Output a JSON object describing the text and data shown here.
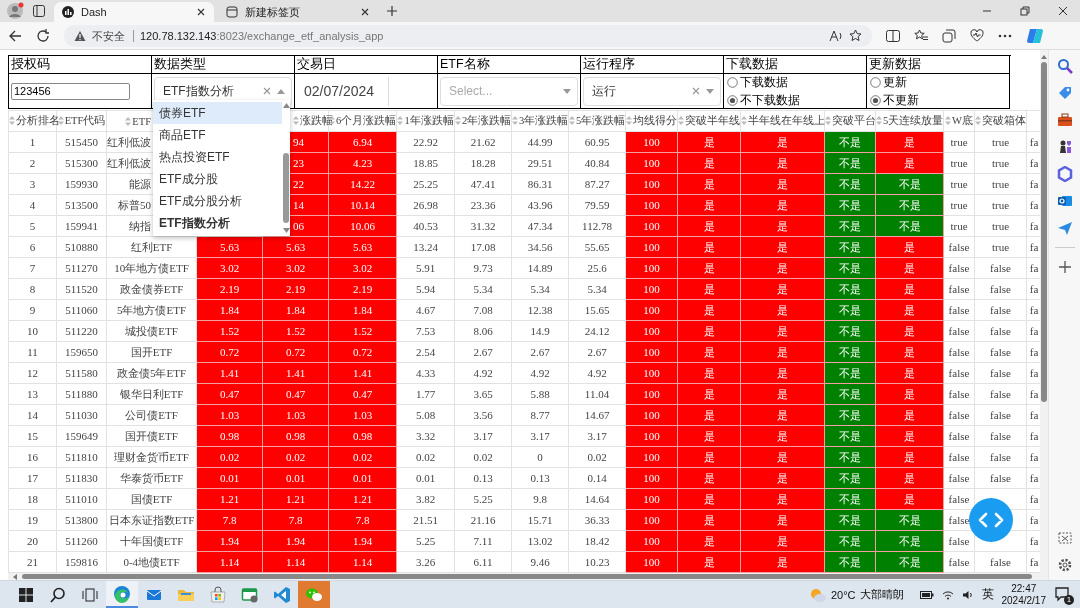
{
  "browser": {
    "tabs": [
      {
        "title": "Dash",
        "selected": true
      },
      {
        "title": "新建标签页",
        "selected": false
      }
    ],
    "security": "不安全",
    "url_host": "120.78.132.143",
    "url_path": ":8023/exchange_etf_analysis_app"
  },
  "form": {
    "fields": [
      {
        "kind": "text",
        "label": "授权码",
        "value": "123456"
      },
      {
        "kind": "dropdown",
        "label": "数据类型",
        "value": "ETF指数分析",
        "clearable": true,
        "expanded": true
      },
      {
        "kind": "date",
        "label": "交易日",
        "value": "02/07/2024"
      },
      {
        "kind": "select",
        "label": "ETF名称",
        "placeholder": "Select...",
        "clearable": false
      },
      {
        "kind": "select",
        "label": "运行程序",
        "value": "运行",
        "clearable": true
      },
      {
        "kind": "radio",
        "label": "下载数据",
        "options": [
          {
            "label": "下载数据",
            "selected": false
          },
          {
            "label": "不下载数据",
            "selected": true
          }
        ]
      },
      {
        "kind": "radio",
        "label": "更新数据",
        "options": [
          {
            "label": "更新",
            "selected": false
          },
          {
            "label": "不更新",
            "selected": true
          }
        ]
      }
    ]
  },
  "dropdown_menu": {
    "options": [
      {
        "label": "债券ETF",
        "highlighted": true,
        "selected": false
      },
      {
        "label": "商品ETF",
        "highlighted": false,
        "selected": false
      },
      {
        "label": "热点投资ETF",
        "highlighted": false,
        "selected": false
      },
      {
        "label": "ETF成分股",
        "highlighted": false,
        "selected": false
      },
      {
        "label": "ETF成分股分析",
        "highlighted": false,
        "selected": false
      },
      {
        "label": "ETF指数分析",
        "highlighted": false,
        "selected": true
      }
    ]
  },
  "table": {
    "columns": [
      "分析排名",
      "ETF代码",
      {
        "label": "ETF",
        "partial": true
      },
      null,
      {
        "label": "涨跌幅",
        "partial": true
      },
      "6个月涨跌幅",
      "1年涨跌幅",
      "2年涨跌幅",
      "3年涨跌幅",
      "5年涨跌幅",
      "均线得分",
      "突破半年线",
      "半年线在年线上",
      "突破平台",
      "5天连续放量",
      "W底",
      "突破箱体",
      null
    ],
    "rows": [
      {
        "cells": [
          "1",
          "515450",
          {
            "text": "红利低波",
            "partial": true
          },
          null,
          {
            "text": "94",
            "color": "#ff0000",
            "partial": true
          },
          {
            "text": "6.94",
            "color": "#ff0000"
          },
          "22.92",
          "21.62",
          "44.99",
          "60.95",
          {
            "text": "100",
            "color": "#ff0000"
          },
          {
            "text": "是",
            "color": "#ff0000"
          },
          {
            "text": "是",
            "color": "#ff0000"
          },
          {
            "text": "不是",
            "color": "#008000"
          },
          {
            "text": "是",
            "color": "#ff0000"
          },
          "true",
          "true",
          "fa"
        ]
      },
      {
        "cells": [
          "2",
          "515300",
          {
            "text": "红利低波",
            "partial": true
          },
          null,
          {
            "text": "23",
            "color": "#ff0000",
            "partial": true
          },
          {
            "text": "4.23",
            "color": "#ff0000"
          },
          "18.85",
          "18.28",
          "29.51",
          "40.84",
          {
            "text": "100",
            "color": "#ff0000"
          },
          {
            "text": "是",
            "color": "#ff0000"
          },
          {
            "text": "是",
            "color": "#ff0000"
          },
          {
            "text": "不是",
            "color": "#008000"
          },
          {
            "text": "是",
            "color": "#ff0000"
          },
          "true",
          "true",
          "fa"
        ]
      },
      {
        "cells": [
          "3",
          "159930",
          {
            "text": "能源",
            "partial": true
          },
          null,
          {
            "text": "22",
            "color": "#ff0000",
            "partial": true
          },
          {
            "text": "14.22",
            "color": "#ff0000"
          },
          "25.25",
          "47.41",
          "86.31",
          "87.27",
          {
            "text": "100",
            "color": "#ff0000"
          },
          {
            "text": "是",
            "color": "#ff0000"
          },
          {
            "text": "是",
            "color": "#ff0000"
          },
          {
            "text": "不是",
            "color": "#008000"
          },
          {
            "text": "不是",
            "color": "#008000"
          },
          "true",
          "true",
          "fa"
        ]
      },
      {
        "cells": [
          "4",
          "513500",
          {
            "text": "标普50",
            "partial": true
          },
          null,
          {
            "text": "14",
            "color": "#ff0000",
            "partial": true
          },
          {
            "text": "10.14",
            "color": "#ff0000"
          },
          "26.98",
          "23.36",
          "43.96",
          "79.59",
          {
            "text": "100",
            "color": "#ff0000"
          },
          {
            "text": "是",
            "color": "#ff0000"
          },
          {
            "text": "是",
            "color": "#ff0000"
          },
          {
            "text": "不是",
            "color": "#008000"
          },
          {
            "text": "不是",
            "color": "#008000"
          },
          "true",
          "true",
          "fa"
        ]
      },
      {
        "cells": [
          "5",
          "159941",
          {
            "text": "纳指",
            "partial": true
          },
          null,
          {
            "text": "06",
            "color": "#ff0000",
            "partial": true
          },
          {
            "text": "10.06",
            "color": "#ff0000"
          },
          "40.53",
          "31.32",
          "47.34",
          "112.78",
          {
            "text": "100",
            "color": "#ff0000"
          },
          {
            "text": "是",
            "color": "#ff0000"
          },
          {
            "text": "是",
            "color": "#ff0000"
          },
          {
            "text": "不是",
            "color": "#008000"
          },
          {
            "text": "不是",
            "color": "#008000"
          },
          "true",
          "true",
          "fa"
        ]
      },
      {
        "cells": [
          "6",
          "510880",
          "红利ETF",
          {
            "text": "5.63",
            "color": "#ff0000"
          },
          {
            "text": "5.63",
            "color": "#ff0000"
          },
          {
            "text": "5.63",
            "color": "#ff0000"
          },
          "13.24",
          "17.08",
          "34.56",
          "55.65",
          {
            "text": "100",
            "color": "#ff0000"
          },
          {
            "text": "是",
            "color": "#ff0000"
          },
          {
            "text": "是",
            "color": "#ff0000"
          },
          {
            "text": "不是",
            "color": "#008000"
          },
          {
            "text": "是",
            "color": "#ff0000"
          },
          "false",
          "true",
          "fa"
        ]
      },
      {
        "cells": [
          "7",
          "511270",
          "10年地方债ETF",
          {
            "text": "3.02",
            "color": "#ff0000"
          },
          {
            "text": "3.02",
            "color": "#ff0000"
          },
          {
            "text": "3.02",
            "color": "#ff0000"
          },
          "5.91",
          "9.73",
          "14.89",
          "25.6",
          {
            "text": "100",
            "color": "#ff0000"
          },
          {
            "text": "是",
            "color": "#ff0000"
          },
          {
            "text": "是",
            "color": "#ff0000"
          },
          {
            "text": "不是",
            "color": "#008000"
          },
          {
            "text": "是",
            "color": "#ff0000"
          },
          "false",
          "false",
          "fa"
        ]
      },
      {
        "cells": [
          "8",
          "511520",
          "政金债券ETF",
          {
            "text": "2.19",
            "color": "#ff0000"
          },
          {
            "text": "2.19",
            "color": "#ff0000"
          },
          {
            "text": "2.19",
            "color": "#ff0000"
          },
          "5.94",
          "5.34",
          "5.34",
          "5.34",
          {
            "text": "100",
            "color": "#ff0000"
          },
          {
            "text": "是",
            "color": "#ff0000"
          },
          {
            "text": "是",
            "color": "#ff0000"
          },
          {
            "text": "不是",
            "color": "#008000"
          },
          {
            "text": "是",
            "color": "#ff0000"
          },
          "false",
          "false",
          "fa"
        ]
      },
      {
        "cells": [
          "9",
          "511060",
          "5年地方债ETF",
          {
            "text": "1.84",
            "color": "#ff0000"
          },
          {
            "text": "1.84",
            "color": "#ff0000"
          },
          {
            "text": "1.84",
            "color": "#ff0000"
          },
          "4.67",
          "7.08",
          "12.38",
          "15.65",
          {
            "text": "100",
            "color": "#ff0000"
          },
          {
            "text": "是",
            "color": "#ff0000"
          },
          {
            "text": "是",
            "color": "#ff0000"
          },
          {
            "text": "不是",
            "color": "#008000"
          },
          {
            "text": "是",
            "color": "#ff0000"
          },
          "false",
          "false",
          "fa"
        ]
      },
      {
        "cells": [
          "10",
          "511220",
          "城投债ETF",
          {
            "text": "1.52",
            "color": "#ff0000"
          },
          {
            "text": "1.52",
            "color": "#ff0000"
          },
          {
            "text": "1.52",
            "color": "#ff0000"
          },
          "7.53",
          "8.06",
          "14.9",
          "24.12",
          {
            "text": "100",
            "color": "#ff0000"
          },
          {
            "text": "是",
            "color": "#ff0000"
          },
          {
            "text": "是",
            "color": "#ff0000"
          },
          {
            "text": "不是",
            "color": "#008000"
          },
          {
            "text": "是",
            "color": "#ff0000"
          },
          "false",
          "false",
          "fa"
        ]
      },
      {
        "cells": [
          "11",
          "159650",
          "国开ETF",
          {
            "text": "0.72",
            "color": "#ff0000"
          },
          {
            "text": "0.72",
            "color": "#ff0000"
          },
          {
            "text": "0.72",
            "color": "#ff0000"
          },
          "2.54",
          "2.67",
          "2.67",
          "2.67",
          {
            "text": "100",
            "color": "#ff0000"
          },
          {
            "text": "是",
            "color": "#ff0000"
          },
          {
            "text": "是",
            "color": "#ff0000"
          },
          {
            "text": "不是",
            "color": "#008000"
          },
          {
            "text": "是",
            "color": "#ff0000"
          },
          "false",
          "false",
          "fa"
        ]
      },
      {
        "cells": [
          "12",
          "511580",
          "政金债5年ETF",
          {
            "text": "1.41",
            "color": "#ff0000"
          },
          {
            "text": "1.41",
            "color": "#ff0000"
          },
          {
            "text": "1.41",
            "color": "#ff0000"
          },
          "4.33",
          "4.92",
          "4.92",
          "4.92",
          {
            "text": "100",
            "color": "#ff0000"
          },
          {
            "text": "是",
            "color": "#ff0000"
          },
          {
            "text": "是",
            "color": "#ff0000"
          },
          {
            "text": "不是",
            "color": "#008000"
          },
          {
            "text": "是",
            "color": "#ff0000"
          },
          "false",
          "false",
          "fa"
        ]
      },
      {
        "cells": [
          "13",
          "511880",
          "银华日利ETF",
          {
            "text": "0.47",
            "color": "#ff0000"
          },
          {
            "text": "0.47",
            "color": "#ff0000"
          },
          {
            "text": "0.47",
            "color": "#ff0000"
          },
          "1.77",
          "3.65",
          "5.88",
          "11.04",
          {
            "text": "100",
            "color": "#ff0000"
          },
          {
            "text": "是",
            "color": "#ff0000"
          },
          {
            "text": "是",
            "color": "#ff0000"
          },
          {
            "text": "不是",
            "color": "#008000"
          },
          {
            "text": "是",
            "color": "#ff0000"
          },
          "false",
          "false",
          "fa"
        ]
      },
      {
        "cells": [
          "14",
          "511030",
          "公司债ETF",
          {
            "text": "1.03",
            "color": "#ff0000"
          },
          {
            "text": "1.03",
            "color": "#ff0000"
          },
          {
            "text": "1.03",
            "color": "#ff0000"
          },
          "5.08",
          "3.56",
          "8.77",
          "14.67",
          {
            "text": "100",
            "color": "#ff0000"
          },
          {
            "text": "是",
            "color": "#ff0000"
          },
          {
            "text": "是",
            "color": "#ff0000"
          },
          {
            "text": "不是",
            "color": "#008000"
          },
          {
            "text": "是",
            "color": "#ff0000"
          },
          "false",
          "false",
          "fa"
        ]
      },
      {
        "cells": [
          "15",
          "159649",
          "国开债ETF",
          {
            "text": "0.98",
            "color": "#ff0000"
          },
          {
            "text": "0.98",
            "color": "#ff0000"
          },
          {
            "text": "0.98",
            "color": "#ff0000"
          },
          "3.32",
          "3.17",
          "3.17",
          "3.17",
          {
            "text": "100",
            "color": "#ff0000"
          },
          {
            "text": "是",
            "color": "#ff0000"
          },
          {
            "text": "是",
            "color": "#ff0000"
          },
          {
            "text": "不是",
            "color": "#008000"
          },
          {
            "text": "是",
            "color": "#ff0000"
          },
          "false",
          "false",
          "fa"
        ]
      },
      {
        "cells": [
          "16",
          "511810",
          "理财金货币ETF",
          {
            "text": "0.02",
            "color": "#ff0000"
          },
          {
            "text": "0.02",
            "color": "#ff0000"
          },
          {
            "text": "0.02",
            "color": "#ff0000"
          },
          "0.02",
          "0.02",
          "0",
          "0.02",
          {
            "text": "100",
            "color": "#ff0000"
          },
          {
            "text": "是",
            "color": "#ff0000"
          },
          {
            "text": "是",
            "color": "#ff0000"
          },
          {
            "text": "不是",
            "color": "#008000"
          },
          {
            "text": "是",
            "color": "#ff0000"
          },
          "false",
          "false",
          "fa"
        ]
      },
      {
        "cells": [
          "17",
          "511830",
          "华泰货币ETF",
          {
            "text": "0.01",
            "color": "#ff0000"
          },
          {
            "text": "0.01",
            "color": "#ff0000"
          },
          {
            "text": "0.01",
            "color": "#ff0000"
          },
          "0.01",
          "0.13",
          "0.13",
          "0.14",
          {
            "text": "100",
            "color": "#ff0000"
          },
          {
            "text": "是",
            "color": "#ff0000"
          },
          {
            "text": "是",
            "color": "#ff0000"
          },
          {
            "text": "不是",
            "color": "#008000"
          },
          {
            "text": "是",
            "color": "#ff0000"
          },
          "false",
          "false",
          "fa"
        ]
      },
      {
        "cells": [
          "18",
          "511010",
          "国债ETF",
          {
            "text": "1.21",
            "color": "#ff0000"
          },
          {
            "text": "1.21",
            "color": "#ff0000"
          },
          {
            "text": "1.21",
            "color": "#ff0000"
          },
          "3.82",
          "5.25",
          "9.8",
          "14.64",
          {
            "text": "100",
            "color": "#ff0000"
          },
          {
            "text": "是",
            "color": "#ff0000"
          },
          {
            "text": "是",
            "color": "#ff0000"
          },
          {
            "text": "不是",
            "color": "#008000"
          },
          {
            "text": "是",
            "color": "#ff0000"
          },
          "false",
          null,
          "fa"
        ]
      },
      {
        "cells": [
          "19",
          "513800",
          "日本东证指数ETF",
          {
            "text": "7.8",
            "color": "#ff0000"
          },
          {
            "text": "7.8",
            "color": "#ff0000"
          },
          {
            "text": "7.8",
            "color": "#ff0000"
          },
          "21.51",
          "21.16",
          "15.71",
          "36.33",
          {
            "text": "100",
            "color": "#ff0000"
          },
          {
            "text": "是",
            "color": "#ff0000"
          },
          {
            "text": "是",
            "color": "#ff0000"
          },
          {
            "text": "不是",
            "color": "#008000"
          },
          {
            "text": "不是",
            "color": "#008000"
          },
          "false",
          null,
          "fa"
        ]
      },
      {
        "cells": [
          "20",
          "511260",
          "十年国债ETF",
          {
            "text": "1.94",
            "color": "#ff0000"
          },
          {
            "text": "1.94",
            "color": "#ff0000"
          },
          {
            "text": "1.94",
            "color": "#ff0000"
          },
          "5.25",
          "7.11",
          "13.02",
          "18.42",
          {
            "text": "100",
            "color": "#ff0000"
          },
          {
            "text": "是",
            "color": "#ff0000"
          },
          {
            "text": "是",
            "color": "#ff0000"
          },
          {
            "text": "不是",
            "color": "#008000"
          },
          {
            "text": "不是",
            "color": "#008000"
          },
          "false",
          null,
          "fa"
        ]
      },
      {
        "cells": [
          "21",
          "159816",
          "0-4地债ETF",
          {
            "text": "1.14",
            "color": "#ff0000"
          },
          {
            "text": "1.14",
            "color": "#ff0000"
          },
          {
            "text": "1.14",
            "color": "#ff0000"
          },
          "3.26",
          "6.11",
          "9.46",
          "10.23",
          {
            "text": "100",
            "color": "#ff0000"
          },
          {
            "text": "是",
            "color": "#ff0000"
          },
          {
            "text": "是",
            "color": "#ff0000"
          },
          {
            "text": "不是",
            "color": "#008000"
          },
          {
            "text": "不是",
            "color": "#008000"
          },
          "false",
          "false",
          "fa"
        ]
      }
    ]
  },
  "taskbar": {
    "apps": [
      {
        "kind": "edge",
        "active": true,
        "attention": false
      },
      {
        "kind": "mail",
        "active": false,
        "attention": false
      },
      {
        "kind": "explorer",
        "active": false,
        "attention": false
      },
      {
        "kind": "store",
        "active": false,
        "attention": false
      },
      {
        "kind": "remote",
        "active": false,
        "attention": false
      },
      {
        "kind": "vscode",
        "active": false,
        "attention": false
      },
      {
        "kind": "wechat",
        "active": false,
        "attention": true
      }
    ],
    "temperature": "20°C",
    "weather": "大部晴朗",
    "ime": "英",
    "time": "22:47",
    "date": "2024/2/17",
    "notifications": "1"
  }
}
